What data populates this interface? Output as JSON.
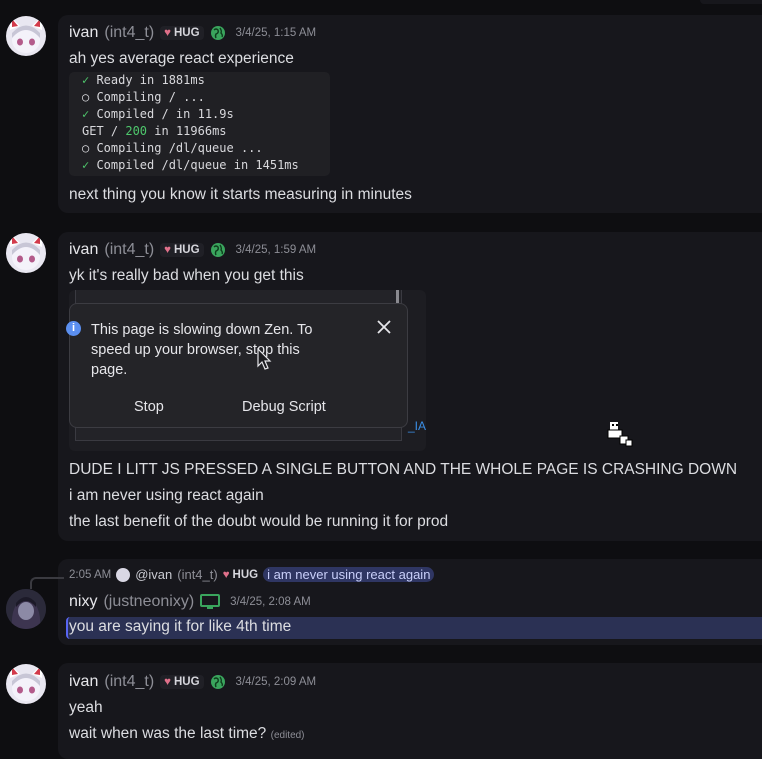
{
  "colors": {
    "bg": "#0e0e11",
    "card": "#17171c",
    "green": "#3aa55d",
    "accent": "#5865f2"
  },
  "messages": [
    {
      "user": "ivan",
      "handle": "(int4_t)",
      "tag": "HUG",
      "timestamp": "3/4/25, 1:15 AM",
      "text": "ah yes average react experience",
      "code": [
        {
          "mark": "✓",
          "text": " Ready in 1881ms"
        },
        {
          "mark": "○",
          "text": " Compiling / ..."
        },
        {
          "mark": "✓",
          "text": " Compiled / in 11.9s"
        },
        {
          "mark": "",
          "pre": "GET / ",
          "status": "200",
          "text": " in 11966ms"
        },
        {
          "mark": "○",
          "text": " Compiling /dl/queue ..."
        },
        {
          "mark": "✓",
          "text": " Compiled /dl/queue in 1451ms"
        },
        {
          "mark": "",
          "text": "  ... "
        }
      ],
      "text2": "next thing you know it starts measuring in minutes"
    },
    {
      "user": "ivan",
      "handle": "(int4_t)",
      "tag": "HUG",
      "timestamp": "3/4/25, 1:59 AM",
      "text": "yk it's really bad when you get this",
      "dialog": {
        "message": "This page is slowing down Zen. To speed up your browser, stop this page.",
        "stop": "Stop",
        "debug": "Debug Script",
        "partial": "_IA"
      },
      "lines": [
        "DUDE I LITT JS PRESSED A SINGLE BUTTON AND THE WHOLE PAGE IS CRASHING DOWN",
        "i am never using react again",
        "the last benefit of the doubt would be running it for prod"
      ]
    },
    {
      "reply": {
        "time": "2:05 AM",
        "mention": "@ivan",
        "handle": "(int4_t)",
        "tag": "HUG",
        "quote": "i am never using react again"
      },
      "user": "nixy",
      "handle": "(justneonixy)",
      "timestamp": "3/4/25, 2:08 AM",
      "text": "you are saying it for like 4th time"
    },
    {
      "user": "ivan",
      "handle": "(int4_t)",
      "tag": "HUG",
      "timestamp": "3/4/25, 2:09 AM",
      "lines": [
        "yeah",
        "wait when was the last time?"
      ],
      "edited": "(edited)"
    }
  ]
}
